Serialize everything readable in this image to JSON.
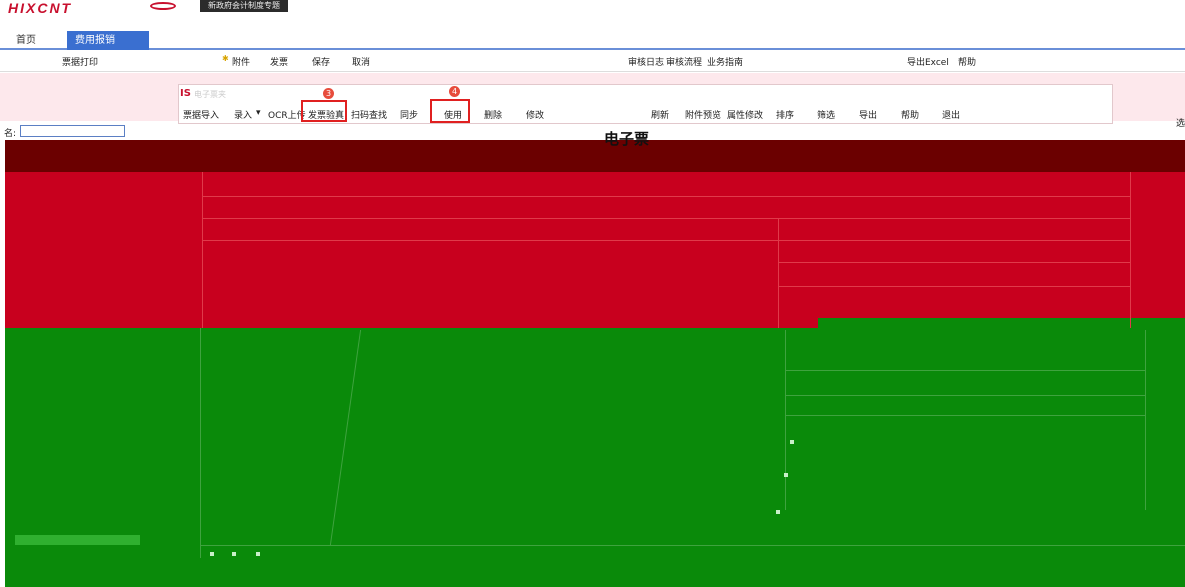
{
  "header": {
    "brand": "HIXCNT",
    "notice": "新政府会计制度专题"
  },
  "tabs": [
    {
      "label": "首页"
    },
    {
      "label": "费用报销"
    }
  ],
  "toolbar1": {
    "print": "票据打印",
    "items": [
      "附件",
      "发票",
      "保存",
      "取消",
      "审核日志",
      "审核流程",
      "业务指南",
      "导出Excel",
      "帮助"
    ]
  },
  "subwindow": {
    "logo": "IS",
    "title": "电子票夹",
    "toolbar": [
      "票据导入",
      "录入",
      "OCR上传",
      "发票验真",
      "扫码查找",
      "同步",
      "使用",
      "删除",
      "修改",
      "刷新",
      "附件预览",
      "属性修改",
      "排序",
      "筛选",
      "导出",
      "帮助",
      "退出"
    ],
    "dropdown_arrow": "▾",
    "markers": [
      "3",
      "4"
    ]
  },
  "left": {
    "label": "名:"
  },
  "right": {
    "label": "选"
  },
  "document": {
    "title": "电子票"
  },
  "colors": {
    "accent": "#3a6fd0",
    "dark_band": "#6b0000",
    "red_band": "#c8001e",
    "green_band": "#0a8a0a",
    "highlight": "#e02020"
  }
}
